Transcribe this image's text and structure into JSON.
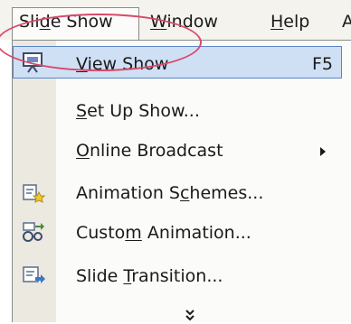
{
  "menubar": {
    "slide_show": "Slide Show",
    "window": "Window",
    "help": "Help",
    "cut_item": "A"
  },
  "menu": {
    "items": [
      {
        "label": "View Show",
        "shortcut": "F5",
        "icon": "projector-screen-icon"
      },
      {
        "label": "Set Up Show..."
      },
      {
        "label": "Online Broadcast",
        "submenu": true
      },
      {
        "label": "Animation Schemes...",
        "icon": "animation-schemes-icon"
      },
      {
        "label": "Custom Animation...",
        "icon": "custom-animation-icon"
      },
      {
        "label": "Slide Transition...",
        "icon": "slide-transition-icon"
      }
    ],
    "expand_glyph": "»"
  },
  "colors": {
    "highlight": "#cfe0f5",
    "highlight_border": "#5b86c5",
    "annotation_ellipse": "#d84a6b"
  }
}
